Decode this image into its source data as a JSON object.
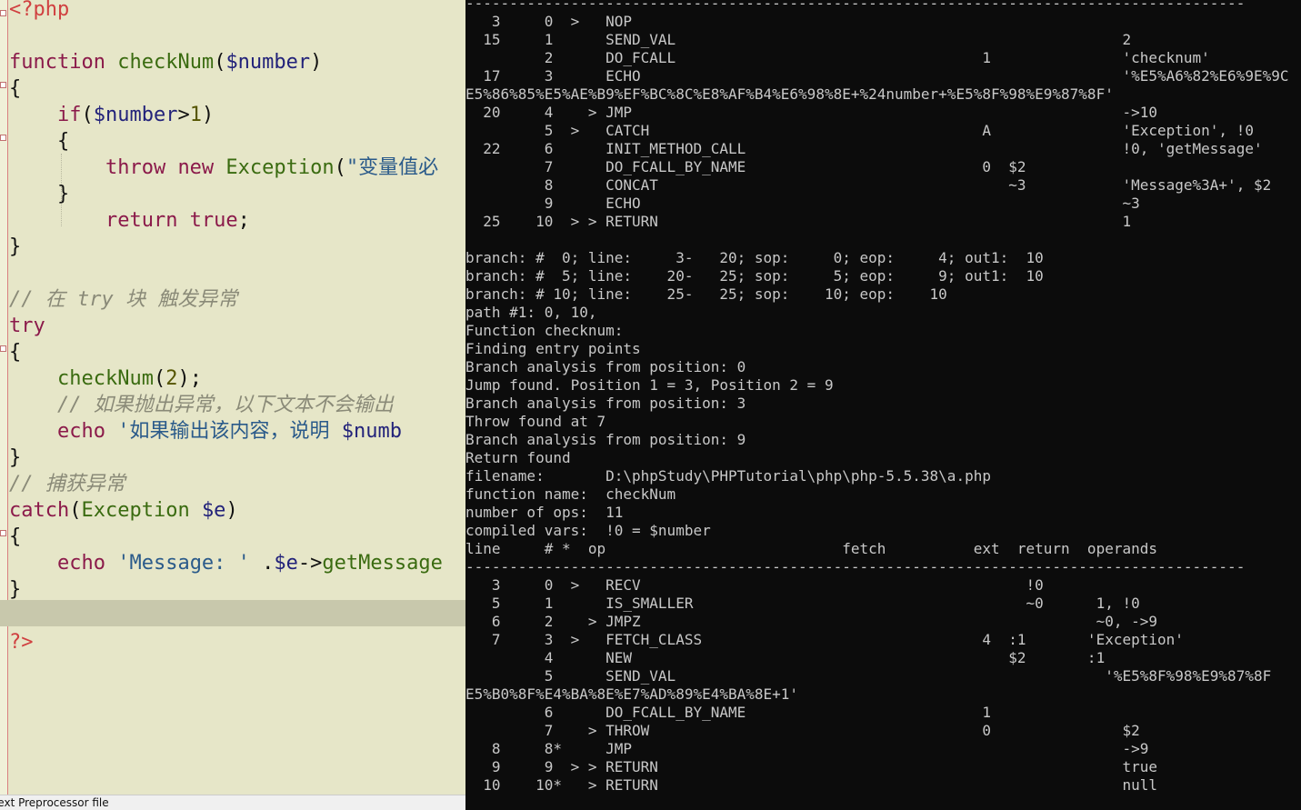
{
  "editor": {
    "code_lines": [
      [
        [
          "php",
          "<?php"
        ]
      ],
      [],
      [
        [
          "kw",
          "function "
        ],
        [
          "fn",
          "checkNum"
        ],
        [
          "pun",
          "("
        ],
        [
          "var",
          "$number"
        ],
        [
          "pun",
          ")"
        ]
      ],
      [
        [
          "pun",
          "{"
        ]
      ],
      [
        [
          "pun",
          "    "
        ],
        [
          "kw",
          "if"
        ],
        [
          "pun",
          "("
        ],
        [
          "var",
          "$number"
        ],
        [
          "pun",
          ">"
        ],
        [
          "num",
          "1"
        ],
        [
          "pun",
          ")"
        ]
      ],
      [
        [
          "pun",
          "    {"
        ]
      ],
      [
        [
          "pun",
          "        "
        ],
        [
          "kw",
          "throw new "
        ],
        [
          "fn",
          "Exception"
        ],
        [
          "pun",
          "("
        ],
        [
          "str",
          "\"变量值必"
        ]
      ],
      [
        [
          "pun",
          "    }"
        ]
      ],
      [
        [
          "pun",
          "        "
        ],
        [
          "kw",
          "return true"
        ],
        [
          "pun",
          ";"
        ]
      ],
      [
        [
          "pun",
          "}"
        ]
      ],
      [],
      [
        [
          "cm",
          "// 在 try 块 触发异常"
        ]
      ],
      [
        [
          "kw",
          "try"
        ]
      ],
      [
        [
          "pun",
          "{"
        ]
      ],
      [
        [
          "pun",
          "    "
        ],
        [
          "fn",
          "checkNum"
        ],
        [
          "pun",
          "("
        ],
        [
          "num",
          "2"
        ],
        [
          "pun",
          ");"
        ]
      ],
      [
        [
          "cm",
          "    // 如果抛出异常，以下文本不会输出"
        ]
      ],
      [
        [
          "pun",
          "    "
        ],
        [
          "kw",
          "echo "
        ],
        [
          "str",
          "'如果输出该内容，说明 "
        ],
        [
          "var",
          "$numb"
        ]
      ],
      [
        [
          "pun",
          "}"
        ]
      ],
      [
        [
          "cm",
          "// 捕获异常"
        ]
      ],
      [
        [
          "kw",
          "catch"
        ],
        [
          "pun",
          "("
        ],
        [
          "fn",
          "Exception "
        ],
        [
          "var",
          "$e"
        ],
        [
          "pun",
          ")"
        ]
      ],
      [
        [
          "pun",
          "{"
        ]
      ],
      [
        [
          "pun",
          "    "
        ],
        [
          "kw",
          "echo "
        ],
        [
          "str",
          "'Message: '"
        ],
        [
          "pun",
          " ."
        ],
        [
          "var",
          "$e"
        ],
        [
          "pun",
          "->"
        ],
        [
          "fn",
          "getMessage"
        ]
      ],
      [
        [
          "pun",
          "}"
        ]
      ],
      [],
      [
        [
          "php",
          "?>"
        ]
      ]
    ],
    "status_text": "Text Preprocessor file"
  },
  "terminal": {
    "lines": [
      "-----------------------------------------------------------------------------------------",
      "   3     0  >   NOP",
      "  15     1      SEND_VAL                                                   2",
      "         2      DO_FCALL                                   1               'checknum'",
      "  17     3      ECHO                                                       '%E5%A6%82%E6%9E%9C",
      "E5%86%85%E5%AE%B9%EF%BC%8C%E8%AF%B4%E6%98%8E+%24number+%E5%8F%98%E9%87%8F'",
      "  20     4    > JMP                                                        ->10",
      "         5  >   CATCH                                      A               'Exception', !0",
      "  22     6      INIT_METHOD_CALL                                           !0, 'getMessage'",
      "         7      DO_FCALL_BY_NAME                           0  $2",
      "         8      CONCAT                                        ~3           'Message%3A+', $2",
      "         9      ECHO                                                       ~3",
      "  25    10  > > RETURN                                                     1",
      "",
      "branch: #  0; line:     3-   20; sop:     0; eop:     4; out1:  10",
      "branch: #  5; line:    20-   25; sop:     5; eop:     9; out1:  10",
      "branch: # 10; line:    25-   25; sop:    10; eop:    10",
      "path #1: 0, 10,",
      "Function checknum:",
      "Finding entry points",
      "Branch analysis from position: 0",
      "Jump found. Position 1 = 3, Position 2 = 9",
      "Branch analysis from position: 3",
      "Throw found at 7",
      "Branch analysis from position: 9",
      "Return found",
      "filename:       D:\\phpStudy\\PHPTutorial\\php\\php-5.5.38\\a.php",
      "function name:  checkNum",
      "number of ops:  11",
      "compiled vars:  !0 = $number",
      "line     # *  op                           fetch          ext  return  operands",
      "-----------------------------------------------------------------------------------------",
      "   3     0  >   RECV                                            !0",
      "   5     1      IS_SMALLER                                      ~0      1, !0",
      "   6     2    > JMPZ                                                    ~0, ->9",
      "   7     3  >   FETCH_CLASS                                4  :1       'Exception'",
      "         4      NEW                                           $2       :1",
      "         5      SEND_VAL                                                 '%E5%8F%98%E9%87%8F",
      "E5%B0%8F%E4%BA%8E%E7%AD%89%E4%BA%8E+1'",
      "         6      DO_FCALL_BY_NAME                           1",
      "         7    > THROW                                      0               $2",
      "   8     8*     JMP                                                        ->9",
      "   9     9  > > RETURN                                                     true",
      "  10    10*   > RETURN                                                     null"
    ]
  }
}
